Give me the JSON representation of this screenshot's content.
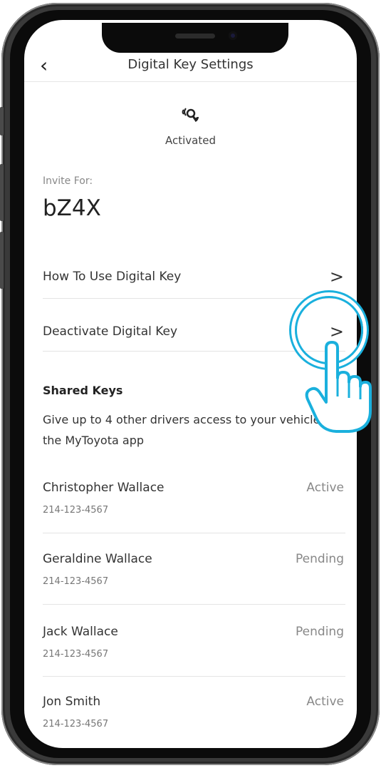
{
  "header": {
    "back_glyph": "‹",
    "title": "Digital Key Settings"
  },
  "key_status": {
    "icon": "key-signal-icon",
    "label": "Activated"
  },
  "invite": {
    "label": "Invite For:",
    "vehicle": "bZ4X"
  },
  "menu": [
    {
      "label": "How To Use Digital Key",
      "chevron": ">"
    },
    {
      "label": "Deactivate Digital Key",
      "chevron": ">"
    }
  ],
  "shared_keys": {
    "title": "Shared Keys",
    "description": "Give up to 4 other drivers access to your vehicle via the MyToyota app",
    "people": [
      {
        "name": "Christopher Wallace",
        "phone": "214-123-4567",
        "status": "Active"
      },
      {
        "name": "Geraldine Wallace",
        "phone": "214-123-4567",
        "status": "Pending"
      },
      {
        "name": "Jack Wallace",
        "phone": "214-123-4567",
        "status": "Pending"
      },
      {
        "name": "Jon Smith",
        "phone": "214-123-4567",
        "status": "Active"
      }
    ]
  },
  "colors": {
    "accent": "#1ab0dd",
    "text": "#333333",
    "muted": "#888888"
  }
}
